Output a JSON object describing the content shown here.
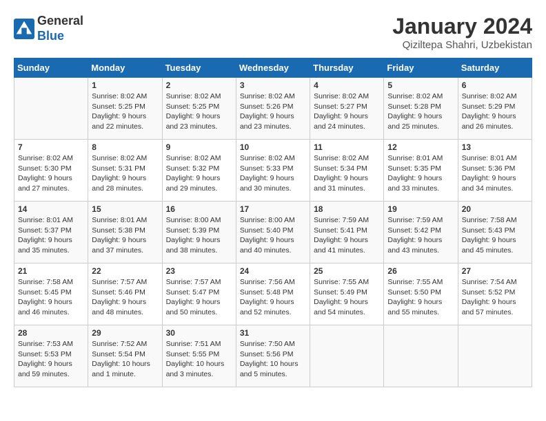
{
  "header": {
    "logo_line1": "General",
    "logo_line2": "Blue",
    "month": "January 2024",
    "location": "Qiziltepa Shahri, Uzbekistan"
  },
  "weekdays": [
    "Sunday",
    "Monday",
    "Tuesday",
    "Wednesday",
    "Thursday",
    "Friday",
    "Saturday"
  ],
  "weeks": [
    [
      {
        "day": "",
        "info": ""
      },
      {
        "day": "1",
        "info": "Sunrise: 8:02 AM\nSunset: 5:25 PM\nDaylight: 9 hours\nand 22 minutes."
      },
      {
        "day": "2",
        "info": "Sunrise: 8:02 AM\nSunset: 5:25 PM\nDaylight: 9 hours\nand 23 minutes."
      },
      {
        "day": "3",
        "info": "Sunrise: 8:02 AM\nSunset: 5:26 PM\nDaylight: 9 hours\nand 23 minutes."
      },
      {
        "day": "4",
        "info": "Sunrise: 8:02 AM\nSunset: 5:27 PM\nDaylight: 9 hours\nand 24 minutes."
      },
      {
        "day": "5",
        "info": "Sunrise: 8:02 AM\nSunset: 5:28 PM\nDaylight: 9 hours\nand 25 minutes."
      },
      {
        "day": "6",
        "info": "Sunrise: 8:02 AM\nSunset: 5:29 PM\nDaylight: 9 hours\nand 26 minutes."
      }
    ],
    [
      {
        "day": "7",
        "info": "Sunrise: 8:02 AM\nSunset: 5:30 PM\nDaylight: 9 hours\nand 27 minutes."
      },
      {
        "day": "8",
        "info": "Sunrise: 8:02 AM\nSunset: 5:31 PM\nDaylight: 9 hours\nand 28 minutes."
      },
      {
        "day": "9",
        "info": "Sunrise: 8:02 AM\nSunset: 5:32 PM\nDaylight: 9 hours\nand 29 minutes."
      },
      {
        "day": "10",
        "info": "Sunrise: 8:02 AM\nSunset: 5:33 PM\nDaylight: 9 hours\nand 30 minutes."
      },
      {
        "day": "11",
        "info": "Sunrise: 8:02 AM\nSunset: 5:34 PM\nDaylight: 9 hours\nand 31 minutes."
      },
      {
        "day": "12",
        "info": "Sunrise: 8:01 AM\nSunset: 5:35 PM\nDaylight: 9 hours\nand 33 minutes."
      },
      {
        "day": "13",
        "info": "Sunrise: 8:01 AM\nSunset: 5:36 PM\nDaylight: 9 hours\nand 34 minutes."
      }
    ],
    [
      {
        "day": "14",
        "info": "Sunrise: 8:01 AM\nSunset: 5:37 PM\nDaylight: 9 hours\nand 35 minutes."
      },
      {
        "day": "15",
        "info": "Sunrise: 8:01 AM\nSunset: 5:38 PM\nDaylight: 9 hours\nand 37 minutes."
      },
      {
        "day": "16",
        "info": "Sunrise: 8:00 AM\nSunset: 5:39 PM\nDaylight: 9 hours\nand 38 minutes."
      },
      {
        "day": "17",
        "info": "Sunrise: 8:00 AM\nSunset: 5:40 PM\nDaylight: 9 hours\nand 40 minutes."
      },
      {
        "day": "18",
        "info": "Sunrise: 7:59 AM\nSunset: 5:41 PM\nDaylight: 9 hours\nand 41 minutes."
      },
      {
        "day": "19",
        "info": "Sunrise: 7:59 AM\nSunset: 5:42 PM\nDaylight: 9 hours\nand 43 minutes."
      },
      {
        "day": "20",
        "info": "Sunrise: 7:58 AM\nSunset: 5:43 PM\nDaylight: 9 hours\nand 45 minutes."
      }
    ],
    [
      {
        "day": "21",
        "info": "Sunrise: 7:58 AM\nSunset: 5:45 PM\nDaylight: 9 hours\nand 46 minutes."
      },
      {
        "day": "22",
        "info": "Sunrise: 7:57 AM\nSunset: 5:46 PM\nDaylight: 9 hours\nand 48 minutes."
      },
      {
        "day": "23",
        "info": "Sunrise: 7:57 AM\nSunset: 5:47 PM\nDaylight: 9 hours\nand 50 minutes."
      },
      {
        "day": "24",
        "info": "Sunrise: 7:56 AM\nSunset: 5:48 PM\nDaylight: 9 hours\nand 52 minutes."
      },
      {
        "day": "25",
        "info": "Sunrise: 7:55 AM\nSunset: 5:49 PM\nDaylight: 9 hours\nand 54 minutes."
      },
      {
        "day": "26",
        "info": "Sunrise: 7:55 AM\nSunset: 5:50 PM\nDaylight: 9 hours\nand 55 minutes."
      },
      {
        "day": "27",
        "info": "Sunrise: 7:54 AM\nSunset: 5:52 PM\nDaylight: 9 hours\nand 57 minutes."
      }
    ],
    [
      {
        "day": "28",
        "info": "Sunrise: 7:53 AM\nSunset: 5:53 PM\nDaylight: 9 hours\nand 59 minutes."
      },
      {
        "day": "29",
        "info": "Sunrise: 7:52 AM\nSunset: 5:54 PM\nDaylight: 10 hours\nand 1 minute."
      },
      {
        "day": "30",
        "info": "Sunrise: 7:51 AM\nSunset: 5:55 PM\nDaylight: 10 hours\nand 3 minutes."
      },
      {
        "day": "31",
        "info": "Sunrise: 7:50 AM\nSunset: 5:56 PM\nDaylight: 10 hours\nand 5 minutes."
      },
      {
        "day": "",
        "info": ""
      },
      {
        "day": "",
        "info": ""
      },
      {
        "day": "",
        "info": ""
      }
    ]
  ]
}
